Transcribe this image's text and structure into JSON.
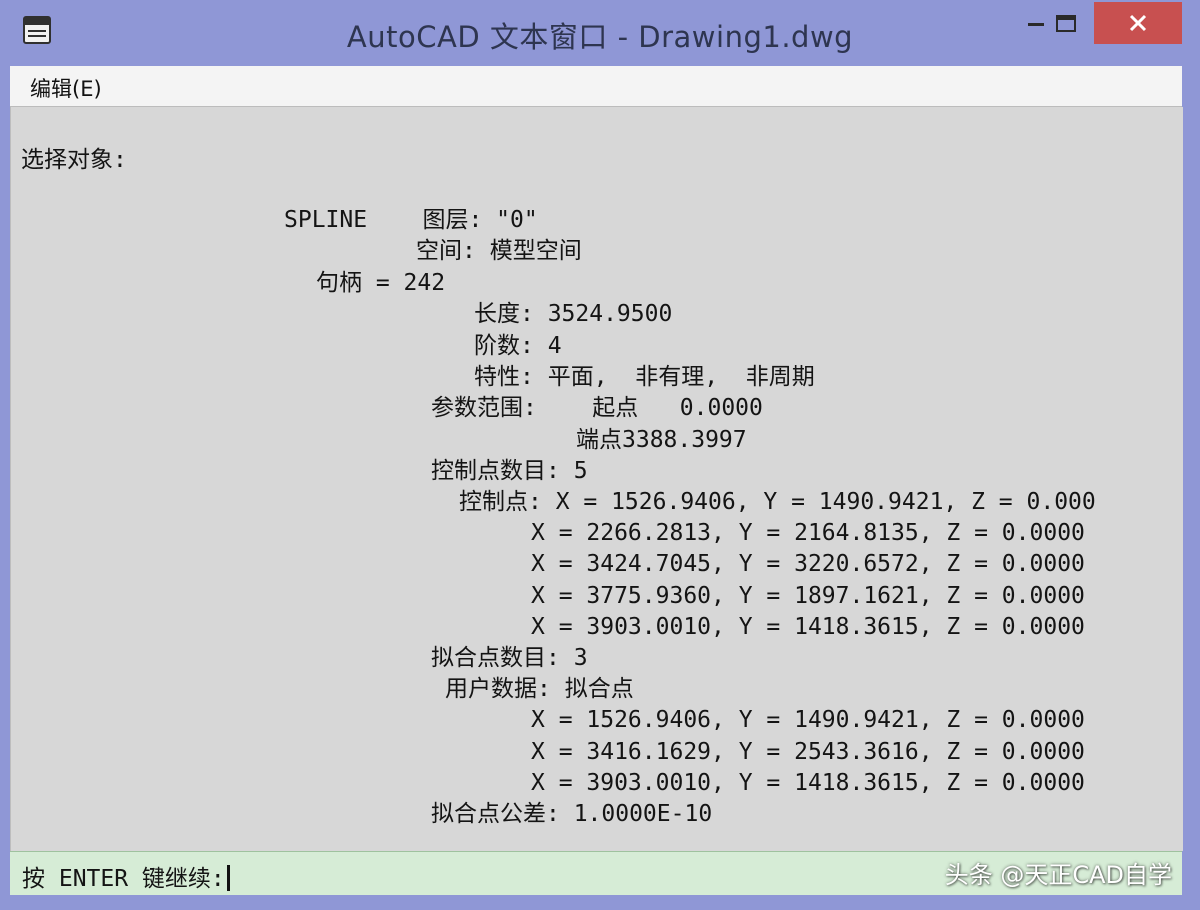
{
  "window": {
    "title": "AutoCAD 文本窗口 - Drawing1.dwg",
    "controls": {
      "minimize": "minimize-icon",
      "maximize": "maximize-icon",
      "close": "close-icon"
    }
  },
  "menu": {
    "edit_label": "编辑(E)"
  },
  "output": {
    "lines": [
      "选择对象:",
      "SPLINE    图层: \"0\"",
      "空间: 模型空间",
      "句柄 = 242",
      "长度: 3524.9500",
      "阶数: 4",
      "特性: 平面,  非有理,  非周期",
      "参数范围:    起点   0.0000",
      "端点3388.3997",
      "控制点数目: 5",
      "控制点: X = 1526.9406, Y = 1490.9421, Z = 0.000",
      "X = 2266.2813, Y = 2164.8135, Z = 0.0000",
      "X = 3424.7045, Y = 3220.6572, Z = 0.0000",
      "X = 3775.9360, Y = 1897.1621, Z = 0.0000",
      "X = 3903.0010, Y = 1418.3615, Z = 0.0000",
      "拟合点数目: 3",
      "用户数据: 拟合点",
      "X = 1526.9406, Y = 1490.9421, Z = 0.0000",
      "X = 3416.1629, Y = 2543.3616, Z = 0.0000",
      "X = 3903.0010, Y = 1418.3615, Z = 0.0000",
      "拟合点公差: 1.0000E-10"
    ]
  },
  "prompt": {
    "text": "按 ENTER 键继续:"
  },
  "watermark": {
    "text": "头条 @天正CAD自学"
  },
  "colors": {
    "titlebar": "#8f97d6",
    "close_button": "#c85050",
    "text_area": "#d7d7d7",
    "prompt_area": "#d6ecd6"
  }
}
